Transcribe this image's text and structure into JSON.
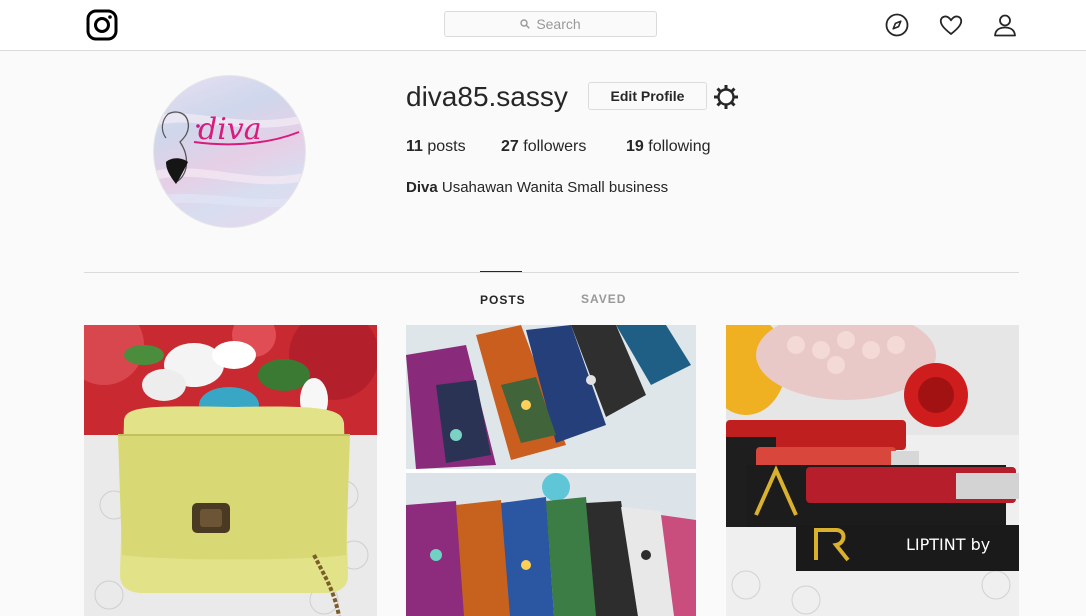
{
  "nav": {
    "search_placeholder": "Search"
  },
  "profile": {
    "username": "diva85.sassy",
    "edit_label": "Edit Profile",
    "posts_count": "11",
    "posts_label": "posts",
    "followers_count": "27",
    "followers_label": "followers",
    "following_count": "19",
    "following_label": "following",
    "bio_name": "Diva",
    "bio_text": "Usahawan Wanita Small business",
    "avatar_text": "diva"
  },
  "tabs": [
    {
      "label": "POSTS",
      "active": true
    },
    {
      "label": "SAVED",
      "active": false
    }
  ],
  "posts": [
    {
      "icon": "photo-yellow-bag-flowers"
    },
    {
      "icon": "photo-patterned-fabric-pouches"
    },
    {
      "icon": "photo-liptint-lipsticks"
    }
  ],
  "colors": {
    "border": "#dbdbdb",
    "text": "#262626",
    "muted": "#999999",
    "background": "#fafafa"
  }
}
